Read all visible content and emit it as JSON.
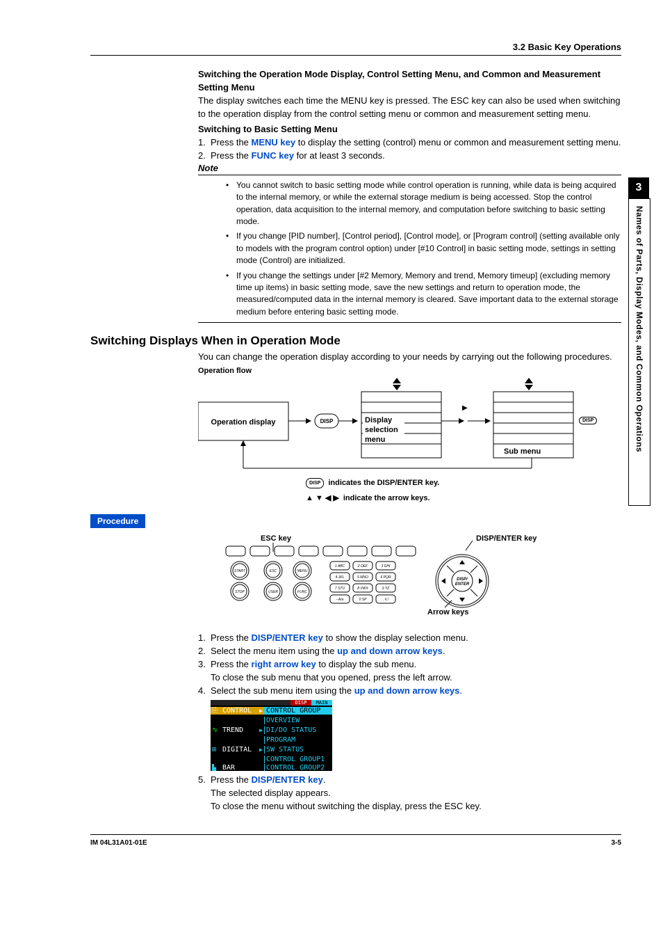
{
  "header": {
    "section": "3.2  Basic Key Operations"
  },
  "side": {
    "chapter_num": "3",
    "chapter_title": "Names of Parts, Display Modes, and Common Operations"
  },
  "sec1": {
    "title": "Switching the Operation Mode Display, Control Setting Menu, and Common and Measurement Setting Menu",
    "para": "The display switches each time the MENU key is pressed.  The ESC key can also be used when switching to the operation display from the control setting menu or common and measurement setting menu.",
    "sub": "Switching to Basic Setting Menu",
    "step1_a": "Press the ",
    "step1_key": "MENU key",
    "step1_b": " to display the setting (control) menu or common and measurement setting menu.",
    "step2_a": "Press the ",
    "step2_key": "FUNC key",
    "step2_b": " for at least 3 seconds."
  },
  "note": {
    "label": "Note",
    "items": [
      "You cannot switch to basic setting mode while control operation is running, while data is being acquired to the internal memory, or while the external storage medium is being accessed.  Stop the control operation, data acquisition to the internal memory, and computation before switching to basic setting mode.",
      "If you change [PID number], [Control period], [Control mode], or [Program control] (setting available only to models with the program control option) under [#10 Control] in basic setting mode, settings in setting mode (Control) are initialized.",
      "If you change the settings under [#2 Memory, Memory and trend, Memory timeup] (excluding memory time up items) in basic setting mode, save the new settings and return to operation mode, the measured/computed data in the internal memory is cleared.  Save important data to the external storage medium before entering basic setting mode."
    ]
  },
  "sec2": {
    "title": "Switching Displays When in Operation Mode",
    "intro": "You can change the operation display according to your needs by carrying out the following procedures.",
    "flow_label": "Operation flow",
    "flow": {
      "box1": "Operation display",
      "disp": "DISP",
      "box2a": "Display",
      "box2b": "selection",
      "box2c": "menu",
      "box3": "Sub menu"
    },
    "legend1_a": "indicates the DISP/ENTER key.",
    "legend2_a": "indicate the arrow keys.",
    "procedure_label": "Procedure",
    "keypad": {
      "esc_label": "ESC key",
      "disp_label": "DISP/ENTER key",
      "arrow_label": "Arrow keys",
      "btn_start": "START",
      "btn_stop": "STOP",
      "btn_esc": "ESC",
      "btn_user": "USER",
      "btn_menu": "MENU",
      "btn_func": "FUNC",
      "btn_disp": "DISP/\nENTER",
      "k1": "1 ABC",
      "k2": "2 DEF",
      "k3": "3 GHI",
      "k4": "4 JKL",
      "k5": "5 MNO",
      "k6": "6 PQR",
      "k7": "7 STU",
      "k8": "8 VWX",
      "k9": "9 YZ",
      "km": "- A/a",
      "k0": "0 SP",
      "kd": ". #,!"
    },
    "steps": {
      "s1a": "Press the ",
      "s1k": "DISP/ENTER key",
      "s1b": " to show the display selection menu.",
      "s2a": "Select the menu item using the ",
      "s2k": "up and down arrow keys",
      "s2b": ".",
      "s3a": "Press the ",
      "s3k": "right arrow key",
      "s3b": " to display the sub menu.",
      "s3c": "To close the sub menu that you opened, press the left arrow.",
      "s4a": "Select the sub menu item using the ",
      "s4k": "up and down arrow keys",
      "s4b": ".",
      "s5a": "Press the ",
      "s5k": "DISP/ENTER key",
      "s5b": ".",
      "s5c": "The selected display appears.",
      "s5d": "To close the menu without switching the display, press the ESC key."
    },
    "menu": {
      "left": [
        "CONTROL",
        "TREND",
        "DIGITAL",
        "BAR"
      ],
      "right": [
        "CONTROL GROUP",
        "OVERVIEW",
        "DI/DO STATUS",
        "PROGRAM",
        "SW STATUS",
        "CONTROL GROUP1",
        "CONTROL GROUP2"
      ],
      "top_red": "DISP",
      "top_cyan": "MAIN"
    }
  },
  "footer": {
    "left": "IM 04L31A01-01E",
    "right": "3-5"
  }
}
